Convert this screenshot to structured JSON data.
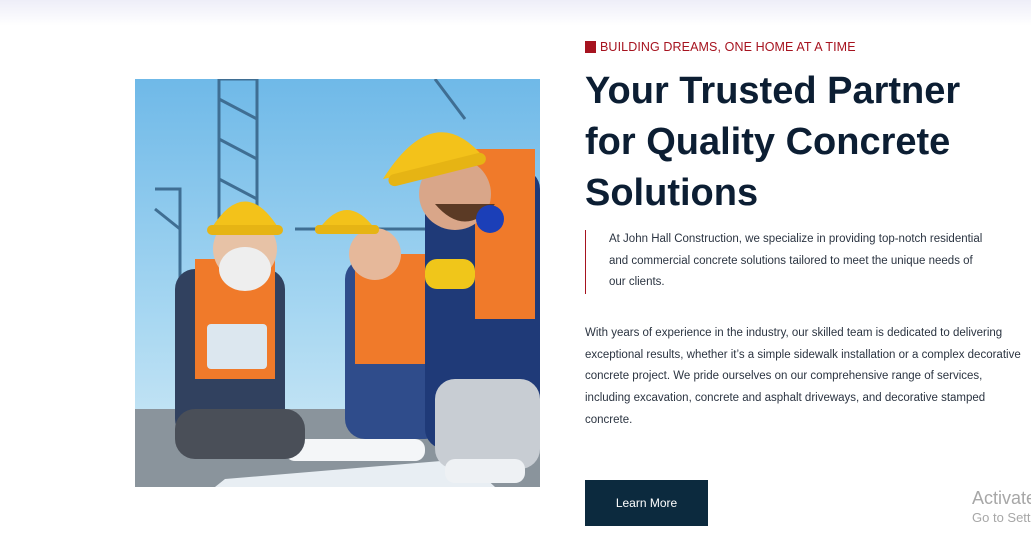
{
  "hero": {
    "image_alt": "Construction workers in hard hats reviewing blueprints on site",
    "eyebrow": "BUILDING DREAMS, ONE HOME AT A TIME",
    "title": "Your Trusted Partner for Quality Concrete Solutions",
    "intro": "At John Hall Construction, we specialize in providing top-notch residential and commercial concrete solutions tailored to meet the unique needs of our clients.",
    "body": "With years of experience in the industry, our skilled team is dedicated to delivering exceptional results, whether it’s a simple sidewalk installation or a complex decorative concrete project. We pride ourselves on our comprehensive range of services, including excavation, concrete and asphalt driveways, and decorative stamped concrete.",
    "cta_label": "Learn More"
  },
  "watermark": {
    "line1": "Activate Windows",
    "line2": "Go to Settings to activate Windows."
  },
  "colors": {
    "accent": "#a6131f",
    "heading": "#0c1e33",
    "button_bg": "#0c2a3e",
    "text": "#2b3441"
  }
}
